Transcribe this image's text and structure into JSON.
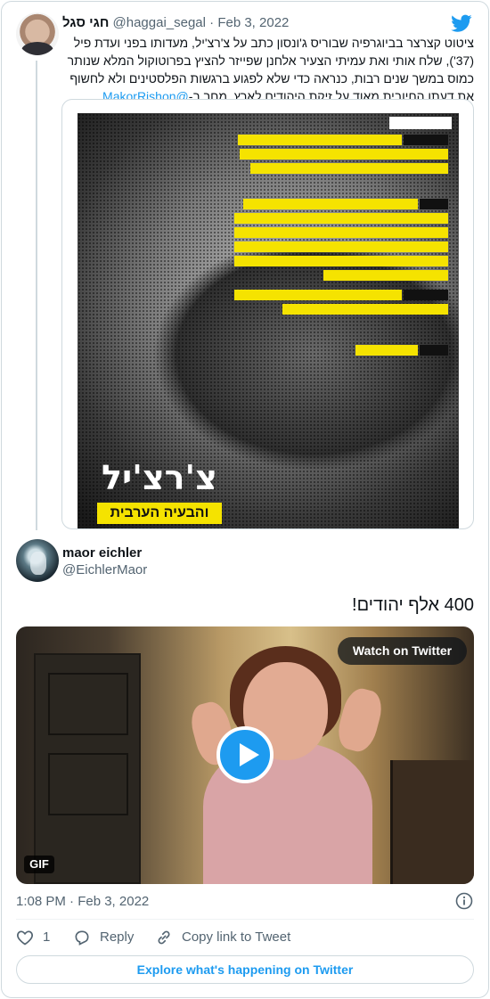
{
  "parent_tweet": {
    "author_name": "חגי סגל",
    "author_handle": "@haggai_segal",
    "date": "Feb 3, 2022",
    "text": "ציטוט קצרצר בביוגרפיה שבוריס ג'ונסון כתב על צ'רצ'יל, מעדותו בפני ועדת פיל (37'), שלח אותי ואת עמיתי הצעיר אלחנן שפייזר להציץ בפרוטוקול המלא שנותר כמוס במשך שנים רבות, כנראה כדי שלא לפגוע ברגשות הפלסטינים ולא לחשוף את דעתו החיובית מאוד על זיקת היהודים לארץ. מחר ב-",
    "mention": "@MakorRishon",
    "image": {
      "title": "צ'רצ'יל",
      "subtitle": "והבעיה הערבית"
    }
  },
  "tweet": {
    "author_name": "maor eichler",
    "author_handle": "@EichlerMaor",
    "text": "400 אלף יהודים!",
    "media": {
      "watch_label": "Watch on Twitter",
      "badge": "GIF"
    },
    "timestamp": "1:08 PM · Feb 3, 2022",
    "actions": {
      "like_count": "1",
      "reply_label": "Reply",
      "copy_label": "Copy link to Tweet"
    },
    "explore_label": "Explore what's happening on Twitter"
  },
  "colors": {
    "accent": "#1d9bf0",
    "text_secondary": "#536471",
    "border": "#cfd9de",
    "highlight_yellow": "#f5e300"
  },
  "icons": [
    "twitter-bird-icon",
    "play-icon",
    "info-icon",
    "heart-icon",
    "reply-icon",
    "link-icon"
  ]
}
